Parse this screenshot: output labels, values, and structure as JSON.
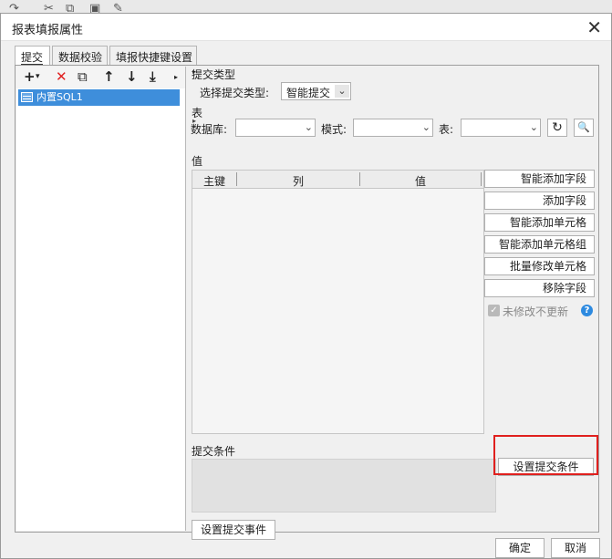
{
  "window": {
    "title": "报表填报属性",
    "close": "✕"
  },
  "tabs": [
    {
      "label": "提交"
    },
    {
      "label": "数据校验"
    },
    {
      "label": "填报快捷键设置"
    }
  ],
  "left_toolbar": {
    "add": "+",
    "add_dropdown": "▾",
    "delete": "✕",
    "copy": "⧉",
    "up": "↑",
    "down": "↓",
    "bottom": "⤓",
    "expand": "▸"
  },
  "tree": {
    "items": [
      {
        "label": "内置SQL1"
      }
    ]
  },
  "submit_type": {
    "section_label": "提交类型",
    "select_label": "选择提交类型:",
    "value": "智能提交"
  },
  "table_section": {
    "section_label": "表",
    "db_label": "数据库:",
    "db_value": "",
    "schema_label": "模式:",
    "schema_value": "",
    "table_label": "表:",
    "table_value": "",
    "refresh_icon": "↻",
    "preview_icon": "🔍"
  },
  "value_section": {
    "section_label": "值",
    "columns": [
      "主键",
      "列",
      "值"
    ],
    "rows": []
  },
  "side_buttons": [
    "智能添加字段",
    "添加字段",
    "智能添加单元格",
    "智能添加单元格组",
    "批量修改单元格",
    "移除字段"
  ],
  "unmodified_checkbox": {
    "label": "未修改不更新",
    "checked": true,
    "check_glyph": "✓",
    "help": "?"
  },
  "condition": {
    "section_label": "提交条件",
    "set_button": "设置提交条件"
  },
  "event_button": "设置提交事件",
  "footer": {
    "ok": "确定",
    "cancel": "取消"
  },
  "colors": {
    "selection": "#3e8edb",
    "highlight_box": "#e0201e",
    "help_icon": "#2d8ae0"
  }
}
